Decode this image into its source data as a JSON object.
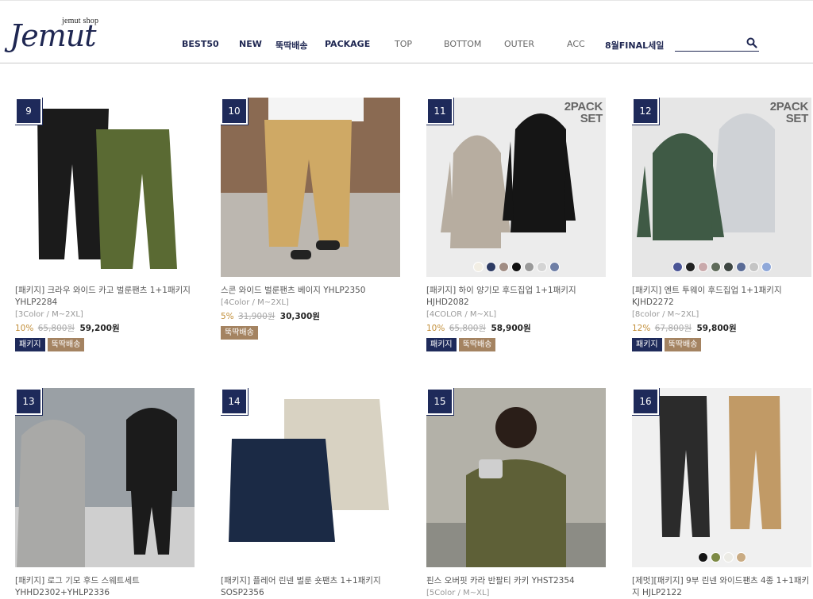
{
  "header": {
    "logo_sub": "jemut shop",
    "logo_main": "Jemut",
    "nav": [
      {
        "label": "BEST50",
        "style": "bold"
      },
      {
        "label": "NEW",
        "style": "bold"
      },
      {
        "label": "뚝딱배송",
        "style": "bold"
      },
      {
        "label": "PACKAGE",
        "style": "bold"
      },
      {
        "label": "TOP",
        "style": "light"
      },
      {
        "label": "BOTTOM",
        "style": "light"
      },
      {
        "label": "OUTER",
        "style": "light"
      },
      {
        "label": "ACC",
        "style": "light"
      },
      {
        "label": "8월FINAL세일",
        "style": "bold"
      }
    ],
    "search": {
      "value": "",
      "placeholder": ""
    }
  },
  "tags": {
    "pack": "패키지",
    "fast": "뚝딱배송"
  },
  "products": [
    {
      "rank": "9",
      "name": "[패키지] 크라우 와이드 카고 벌룬팬츠 1+1패키지 YHLP2284",
      "option": "[3Color / M~2XL]",
      "rate": "10%",
      "orig": "65,800원",
      "sale": "59,200원",
      "tags": [
        "pack",
        "fast"
      ],
      "pack_badge": [],
      "swatches": []
    },
    {
      "rank": "10",
      "name": "스콘 와이드 벌룬팬츠 베이지 YHLP2350",
      "option": "[4Color / M~2XL]",
      "rate": "5%",
      "orig": "31,900원",
      "sale": "30,300원",
      "tags": [
        "fast"
      ],
      "pack_badge": [],
      "swatches": []
    },
    {
      "rank": "11",
      "name": "[패키지] 하이 양기모 후드집업 1+1패키지 HJHD2082",
      "option": "[4COLOR / M~XL]",
      "rate": "10%",
      "orig": "65,800원",
      "sale": "58,900원",
      "tags": [
        "pack",
        "fast"
      ],
      "pack_badge": [
        "2PACK",
        "SET"
      ],
      "swatches": [
        "#f2eee4",
        "#2d3b63",
        "#a08c83",
        "#111111",
        "#9a9a9a",
        "#d4d4d4",
        "#6f7fa6"
      ]
    },
    {
      "rank": "12",
      "name": "[패키지] 엔트 투웨이 후드집업 1+1패키지 KJHD2272",
      "option": "[8color / M~2XL]",
      "rate": "12%",
      "orig": "67,800원",
      "sale": "59,800원",
      "tags": [
        "pack",
        "fast"
      ],
      "pack_badge": [
        "2PACK",
        "SET"
      ],
      "swatches": [
        "#4b5596",
        "#222222",
        "#c9a9ab",
        "#5f6b5a",
        "#3f4743",
        "#5a6b96",
        "#c4c4c4",
        "#8fa8d9"
      ]
    },
    {
      "rank": "13",
      "name": "[패키지] 로그 기모 후드 스웨트세트 YHHD2302+YHLP2336",
      "option": "",
      "rate": "",
      "orig": "",
      "sale": "",
      "tags": [],
      "pack_badge": [],
      "swatches": []
    },
    {
      "rank": "14",
      "name": "[패키지] 플레어 린넨 벌룬 숏팬츠 1+1패키지 SOSP2356",
      "option": "",
      "rate": "",
      "orig": "",
      "sale": "",
      "tags": [],
      "pack_badge": [],
      "swatches": []
    },
    {
      "rank": "15",
      "name": "핀스 오버핏 카라 반팔티 카키 YHST2354",
      "option": "[5Color / M~XL]",
      "rate": "",
      "orig": "",
      "sale": "",
      "tags": [],
      "pack_badge": [],
      "swatches": []
    },
    {
      "rank": "16",
      "name": "[제멋][패키지] 9부 린넨 와이드팬츠 4종 1+1패키지 HJLP2122",
      "option": "",
      "rate": "",
      "orig": "",
      "sale": "",
      "tags": [],
      "pack_badge": [],
      "swatches": [
        "#151515",
        "#7d8a45",
        "#ecebe5",
        "#c9ab83"
      ]
    }
  ]
}
